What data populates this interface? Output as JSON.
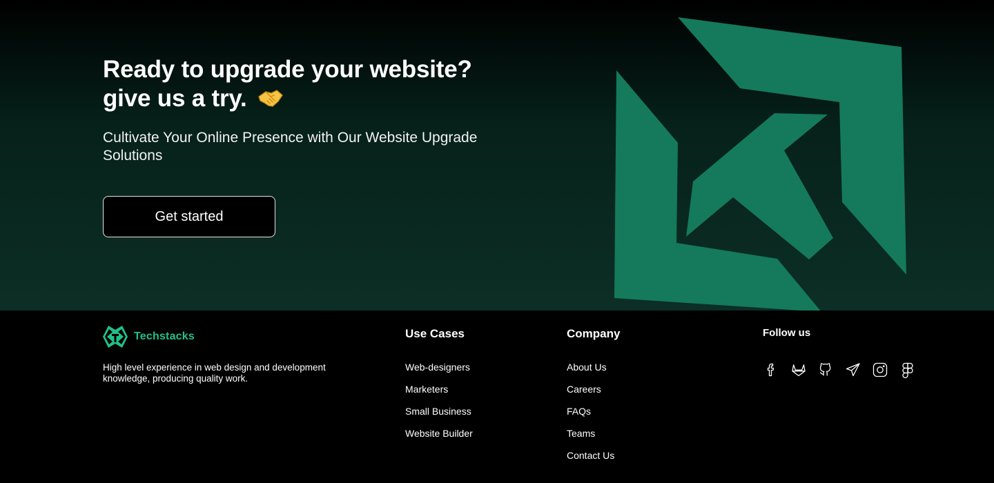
{
  "cta": {
    "title_line1": "Ready to upgrade your website?",
    "title_line2": "give us a try.",
    "emoji_icon": "handshake-icon",
    "subtitle": "Cultivate Your Online Presence with Our Website Upgrade Solutions",
    "button_label": "Get started"
  },
  "brand": {
    "name": "Techstacks",
    "tagline": "High level experience in web design and development knowledge, producing quality work.",
    "accent_color": "#22c08a",
    "mark_color": "#147a5b"
  },
  "footer": {
    "use_cases": {
      "title": "Use Cases",
      "items": [
        "Web-designers",
        "Marketers",
        "Small Business",
        "Website Builder"
      ]
    },
    "company": {
      "title": "Company",
      "items": [
        "About Us",
        "Careers",
        "FAQs",
        "Teams",
        "Contact Us"
      ]
    },
    "follow": {
      "title": "Follow us",
      "icons": [
        "facebook-icon",
        "gitlab-icon",
        "github-icon",
        "telegram-icon",
        "instagram-icon",
        "figma-icon"
      ]
    }
  }
}
